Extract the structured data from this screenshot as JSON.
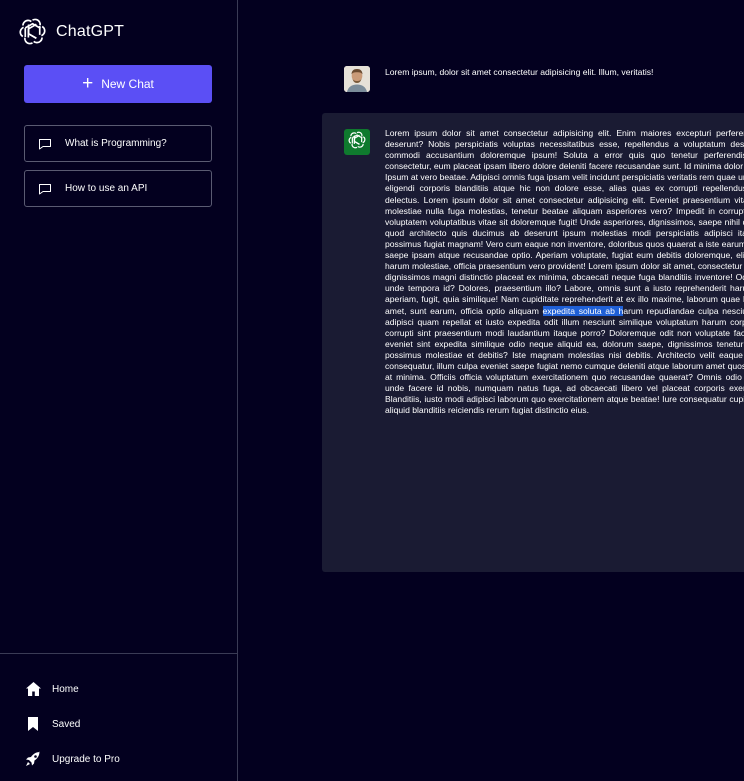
{
  "app": {
    "name": "ChatGPT"
  },
  "sidebar": {
    "new_chat_label": "New Chat",
    "history": [
      {
        "label": "What is Programming?",
        "icon": "chat-bubble-icon"
      },
      {
        "label": "How to use an API",
        "icon": "chat-bubble-icon"
      }
    ],
    "bottom_links": [
      {
        "label": "Home",
        "icon": "home-icon"
      },
      {
        "label": "Saved",
        "icon": "bookmark-icon"
      },
      {
        "label": "Upgrade to Pro",
        "icon": "rocket-icon"
      }
    ]
  },
  "conversation": {
    "user_message": "Lorem ipsum, dolor sit amet consectetur adipisicing elit. Illum, veritatis!",
    "assistant_message": {
      "before_selection": "Lorem ipsum dolor sit amet consectetur adipisicing elit. Enim maiores excepturi perferendis, quos deserunt? Nobis perspiciatis voluptas necessitatibus esse, repellendus a voluptatum deserunt quia commodi accusantium doloremque ipsum! Soluta a error quis quo tenetur perferendis ut quos consectetur, eum placeat ipsam libero dolore deleniti facere recusandae sunt. Id minima dolor ipsa quas. Ipsum at vero beatae. Adipisci omnis fuga ipsam velit incidunt perspiciatis veritatis rem quae unde hic ea, eligendi corporis blanditiis atque hic non dolore esse, alias quas ex corrupti repellendus, illo velit delectus. Lorem ipsum dolor sit amet consectetur adipisicing elit. Eveniet praesentium vitae quidem molestiae nulla fuga molestias, tenetur beatae aliquam asperiores vero? Impedit in corrupti deserunt voluptatem voluptatibus vitae sit doloremque fugit! Unde asperiores, dignissimos, saepe nihil dolore eius quod architecto quis ducimus ab deserunt ipsum molestias modi perspiciatis adipisci itaque, fugit possimus fugiat magnam! Vero cum eaque non inventore, doloribus quos quaerat a iste earum nisi natus saepe ipsam atque recusandae optio. Aperiam voluptate, fugiat eum debitis doloremque, eligendi quis harum molestiae, officia praesentium vero provident! Lorem ipsum dolor sit amet, consectetur adipisicing dignissimos magni distinctio placeat ex minima, obcaecati neque fuga blanditiis inventore! Odio dolores unde tempora id? Dolores, praesentium illo? Labore, omnis sunt a iusto reprehenderit harum tenetur aperiam, fugit, quia similique! Nam cupiditate reprehenderit at ex illo maxime, laborum quae laboriosam amet, sunt earum, officia optio aliquam ",
      "selection": "expedita soluta ab h",
      "after_selection": "arum repudiandae culpa nesciunt non ex adipisci quam repellat et iusto expedita odit illum nesciunt similique voluptatum harum corporis quasi corrupti sint praesentium modi laudantium itaque porro? Doloremque odit non voluptate facere officiis eveniet sint expedita similique odio neque aliquid ea, dolorum saepe, dignissimos tenetur architecto possimus molestiae et debitis? Iste magnam molestias nisi debitis. Architecto velit eaque vel rerum consequatur, illum culpa eveniet saepe fugiat nemo cumque deleniti atque laborum amet quos porro sint at minima. Officiis officia voluptatum exercitationem quo recusandae quaerat? Omnis odio voluptates unde facere id nobis, numquam natus fuga, ad obcaecati libero vel placeat corporis exercitationem Blanditiis, iusto modi adipisci laborum quo exercitationem atque beatae! Iure consequatur cupiditate. Iste aliquid blanditiis reiciendis rerum fugiat distinctio eius."
    }
  },
  "colors": {
    "background": "#03001f",
    "accent": "#5b4ff5",
    "assistant_bubble": "#1a1b33",
    "assistant_avatar": "#0f7a2e",
    "selection": "#1f5fd6"
  }
}
